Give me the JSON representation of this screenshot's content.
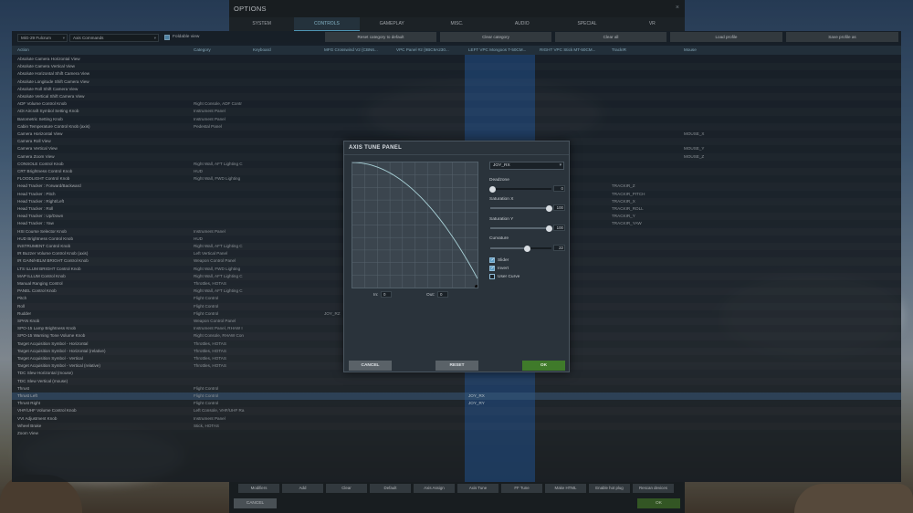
{
  "options_window": {
    "title": "OPTIONS",
    "close": "×",
    "tabs": [
      "SYSTEM",
      "CONTROLS",
      "GAMEPLAY",
      "MISC.",
      "AUDIO",
      "SPECIAL",
      "VR"
    ],
    "active_tab": "CONTROLS"
  },
  "toolbar": {
    "aircraft": "MiG-29 Fulcrum",
    "command_filter": "Axis Commands",
    "foldable_view_label": "Foldable view",
    "foldable_view_checked": true,
    "buttons": [
      "Reset category to default",
      "Clear category",
      "Clear all",
      "Load profile",
      "Save profile as"
    ]
  },
  "columns": [
    "Action",
    "Category",
    "Keyboard",
    "MFG Crosswind V2 {CBN6...",
    "VPC Panel #2 {9BC9A230...",
    "LEFT VPC Mongoos T-50CM...",
    "RIGHT VPC Stick MT-50CM...",
    "TrackIR",
    "Mouse"
  ],
  "rows": [
    {
      "action": "Absolute Camera Horizontal View",
      "category": "",
      "keyboard": "",
      "joy": "",
      "trackir": "",
      "mouse": ""
    },
    {
      "action": "Absolute Camera Vertical View",
      "category": "",
      "keyboard": "",
      "joy": "",
      "trackir": "",
      "mouse": ""
    },
    {
      "action": "Absolute Horizontal Shift Camera View",
      "category": "",
      "keyboard": "",
      "joy": "",
      "trackir": "",
      "mouse": ""
    },
    {
      "action": "Absolute Longitude Shift Camera View",
      "category": "",
      "keyboard": "",
      "joy": "",
      "trackir": "",
      "mouse": ""
    },
    {
      "action": "Absolute Roll Shift Camera View",
      "category": "",
      "keyboard": "",
      "joy": "",
      "trackir": "",
      "mouse": ""
    },
    {
      "action": "Absolute Vertical Shift Camera View",
      "category": "",
      "keyboard": "",
      "joy": "",
      "trackir": "",
      "mouse": ""
    },
    {
      "action": "ADF Volume Control Knob",
      "category": "Right Console, ADF Contr",
      "keyboard": "",
      "joy": "",
      "trackir": "",
      "mouse": ""
    },
    {
      "action": "ADI Aircraft Symbol Setting Knob",
      "category": "Instrument Panel",
      "keyboard": "",
      "joy": "",
      "trackir": "",
      "mouse": ""
    },
    {
      "action": "Barometric Setting Knob",
      "category": "Instrument Panel",
      "keyboard": "",
      "joy": "",
      "trackir": "",
      "mouse": ""
    },
    {
      "action": "Cabin Temperature Control Knob (axis)",
      "category": "Pedestal Panel",
      "keyboard": "",
      "joy": "",
      "trackir": "",
      "mouse": ""
    },
    {
      "action": "Camera Horizontal View",
      "category": "",
      "keyboard": "",
      "joy": "",
      "trackir": "",
      "mouse": "MOUSE_X"
    },
    {
      "action": "Camera Roll View",
      "category": "",
      "keyboard": "",
      "joy": "",
      "trackir": "",
      "mouse": ""
    },
    {
      "action": "Camera Vertical View",
      "category": "",
      "keyboard": "",
      "joy": "",
      "trackir": "",
      "mouse": "MOUSE_Y"
    },
    {
      "action": "Camera Zoom View",
      "category": "",
      "keyboard": "",
      "joy": "",
      "trackir": "",
      "mouse": "MOUSE_Z"
    },
    {
      "action": "CONSOLE Control Knob",
      "category": "Right Wall, AFT Lighting C",
      "keyboard": "",
      "joy": "",
      "trackir": "",
      "mouse": ""
    },
    {
      "action": "CRT Brightness Control Knob",
      "category": "HUD",
      "keyboard": "",
      "joy": "",
      "trackir": "",
      "mouse": ""
    },
    {
      "action": "FLOODLIGHT Control Knob",
      "category": "Right Wall, FWD Lighting",
      "keyboard": "",
      "joy": "",
      "trackir": "",
      "mouse": ""
    },
    {
      "action": "Head Tracker : Forward/Backward",
      "category": "",
      "keyboard": "",
      "joy": "",
      "trackir": "TRACKIR_Z",
      "mouse": ""
    },
    {
      "action": "Head Tracker : Pitch",
      "category": "",
      "keyboard": "",
      "joy": "",
      "trackir": "TRACKIR_PITCH",
      "mouse": ""
    },
    {
      "action": "Head Tracker : Right/Left",
      "category": "",
      "keyboard": "",
      "joy": "",
      "trackir": "TRACKIR_X",
      "mouse": ""
    },
    {
      "action": "Head Tracker : Roll",
      "category": "",
      "keyboard": "",
      "joy": "",
      "trackir": "TRACKIR_ROLL",
      "mouse": ""
    },
    {
      "action": "Head Tracker : Up/Down",
      "category": "",
      "keyboard": "",
      "joy": "",
      "trackir": "TRACKIR_Y",
      "mouse": ""
    },
    {
      "action": "Head Tracker : Yaw",
      "category": "",
      "keyboard": "",
      "joy": "",
      "trackir": "TRACKIR_YAW",
      "mouse": ""
    },
    {
      "action": "HSI Course Selector Knob",
      "category": "Instrument Panel",
      "keyboard": "",
      "joy": "",
      "trackir": "",
      "mouse": ""
    },
    {
      "action": "HUD Brightness Control Knob",
      "category": "HUD",
      "keyboard": "",
      "joy": "",
      "trackir": "",
      "mouse": ""
    },
    {
      "action": "INSTRUMENT Control Knob",
      "category": "Right Wall, AFT Lighting C",
      "keyboard": "",
      "joy": "",
      "trackir": "",
      "mouse": ""
    },
    {
      "action": "IR Buzzer Volume Control Knob (axis)",
      "category": "Left Vertical Panel",
      "keyboard": "",
      "joy": "",
      "trackir": "",
      "mouse": ""
    },
    {
      "action": "IR GAIN/HELM BRIGHT Control Knob",
      "category": "Weapon Control Panel",
      "keyboard": "",
      "joy": "",
      "trackir": "",
      "mouse": ""
    },
    {
      "action": "LTS ILLUM BRIGHT Control Knob",
      "category": "Right Wall, FWD Lighting",
      "keyboard": "",
      "joy": "",
      "trackir": "",
      "mouse": ""
    },
    {
      "action": "MAP ILLUM Control Knob",
      "category": "Right Wall, AFT Lighting C",
      "keyboard": "",
      "joy": "",
      "trackir": "",
      "mouse": ""
    },
    {
      "action": "Manual Ranging Control",
      "category": "Throttles, HOTAS",
      "keyboard": "",
      "joy": "",
      "trackir": "",
      "mouse": ""
    },
    {
      "action": "PANEL Control Knob",
      "category": "Right Wall, AFT Lighting C",
      "keyboard": "",
      "joy": "",
      "trackir": "",
      "mouse": ""
    },
    {
      "action": "Pitch",
      "category": "Flight Control",
      "keyboard": "",
      "joy": "",
      "trackir": "",
      "mouse": ""
    },
    {
      "action": "Roll",
      "category": "Flight Control",
      "keyboard": "",
      "joy": "",
      "trackir": "",
      "mouse": ""
    },
    {
      "action": "Rudder",
      "category": "Flight Control",
      "keyboard": "JOY_RZ",
      "joy": "",
      "trackir": "",
      "mouse": ""
    },
    {
      "action": "SPAN Knob",
      "category": "Weapon Control Panel",
      "keyboard": "",
      "joy": "",
      "trackir": "",
      "mouse": ""
    },
    {
      "action": "SPO-15 Lamp Brightness Knob",
      "category": "Instrument Panel, RHAW I",
      "keyboard": "",
      "joy": "",
      "trackir": "",
      "mouse": ""
    },
    {
      "action": "SPO-15 Warning Tone Volume Knob",
      "category": "Right Console, RHAW Con",
      "keyboard": "",
      "joy": "",
      "trackir": "",
      "mouse": ""
    },
    {
      "action": "Target Acquisition Symbol - Horizontal",
      "category": "Throttles, HOTAS",
      "keyboard": "",
      "joy": "",
      "trackir": "",
      "mouse": ""
    },
    {
      "action": "Target Acquisition Symbol - Horizontal (relative)",
      "category": "Throttles, HOTAS",
      "keyboard": "",
      "joy": "",
      "trackir": "",
      "mouse": ""
    },
    {
      "action": "Target Acquisition Symbol - Vertical",
      "category": "Throttles, HOTAS",
      "keyboard": "",
      "joy": "",
      "trackir": "",
      "mouse": ""
    },
    {
      "action": "Target Acquisition Symbol - Vertical (relative)",
      "category": "Throttles, HOTAS",
      "keyboard": "",
      "joy": "",
      "trackir": "",
      "mouse": ""
    },
    {
      "action": "TDC Slew Horizontal (mouse)",
      "category": "",
      "keyboard": "",
      "joy": "",
      "trackir": "",
      "mouse": ""
    },
    {
      "action": "TDC Slew Vertical (mouse)",
      "category": "",
      "keyboard": "",
      "joy": "",
      "trackir": "",
      "mouse": ""
    },
    {
      "action": "Thrust",
      "category": "Flight Control",
      "keyboard": "",
      "joy": "",
      "trackir": "",
      "mouse": ""
    },
    {
      "action": "Thrust Left",
      "category": "Flight Control",
      "keyboard": "",
      "joy": "JOY_RX",
      "trackir": "",
      "mouse": "",
      "selected": true
    },
    {
      "action": "Thrust Right",
      "category": "Flight Control",
      "keyboard": "",
      "joy": "JOY_RY",
      "trackir": "",
      "mouse": ""
    },
    {
      "action": "VHF/UHF Volume Control Knob",
      "category": "Left Console, VHF/UHF Ra",
      "keyboard": "",
      "joy": "",
      "trackir": "",
      "mouse": ""
    },
    {
      "action": "VVI Adjustment Knob",
      "category": "Instrument Panel",
      "keyboard": "",
      "joy": "",
      "trackir": "",
      "mouse": ""
    },
    {
      "action": "Wheel Brake",
      "category": "Stick, HOTAS",
      "keyboard": "",
      "joy": "",
      "trackir": "",
      "mouse": ""
    },
    {
      "action": "Zoom View",
      "category": "",
      "keyboard": "",
      "joy": "",
      "trackir": "",
      "mouse": ""
    }
  ],
  "bottom_bar": {
    "buttons": [
      "Modifiers",
      "Add",
      "Clear",
      "Default",
      "Axis Assign",
      "Axis Tune",
      "FF Tune",
      "Make HTML",
      "Enable hot plug",
      "Rescan devices"
    ],
    "cancel": "CANCEL",
    "ok": "OK"
  },
  "axis_tune": {
    "title": "AXIS TUNE PANEL",
    "axis": "JOY_RX",
    "deadzone_label": "Deadzone",
    "deadzone": 0,
    "saturation_x_label": "Saturation X",
    "saturation_x": 100,
    "saturation_y_label": "Saturation Y",
    "saturation_y": 100,
    "curvature_label": "Curvature",
    "curvature": 22,
    "slider": {
      "label": "Slider",
      "checked": true
    },
    "invert": {
      "label": "Invert",
      "checked": true
    },
    "user_curve": {
      "label": "User Curve",
      "checked": false
    },
    "in_label": "In:",
    "in_value": "0",
    "out_label": "Out:",
    "out_value": "0",
    "cancel": "CANCEL",
    "reset": "RESET",
    "ok": "OK"
  },
  "colors": {
    "accent": "#5fb4d8",
    "selected_column": "#2a5896",
    "ok_green": "#3f7a2a",
    "curve": "#a8d0d6"
  }
}
